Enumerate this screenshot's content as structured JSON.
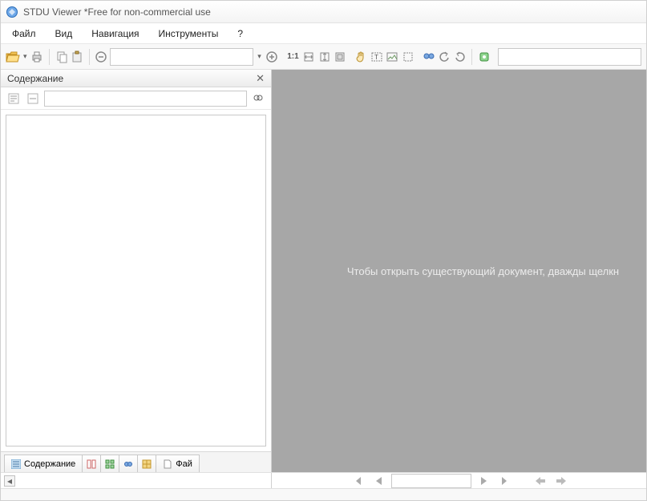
{
  "window": {
    "title": "STDU Viewer *Free for non-commercial use"
  },
  "menu": {
    "file": "Файл",
    "view": "Вид",
    "navigation": "Навигация",
    "tools": "Инструменты",
    "help": "?"
  },
  "toolbar": {
    "open": "open",
    "print": "print",
    "copy": "copy",
    "paste": "paste",
    "zoom_out": "zoom-out",
    "zoom_field": "",
    "zoom_in": "zoom-in",
    "scale_11": "1:1",
    "fit_width": "fit-width",
    "fit_height": "fit-height",
    "fit_page": "fit-page",
    "hand": "hand",
    "select": "select",
    "select_image": "select-image",
    "select_region": "select-region",
    "binoculars": "find",
    "rotate_left": "rotate-left",
    "rotate_right": "rotate-right",
    "settings": "settings",
    "help": "help",
    "search_field": ""
  },
  "sidebar": {
    "title": "Содержание",
    "filter_value": "",
    "tabs": {
      "contents": "Содержание",
      "pages": "",
      "bookmarks": "",
      "search": "",
      "thumbnails": "",
      "files": "Фай"
    }
  },
  "canvas": {
    "hint": "Чтобы открыть существующий документ, дважды щелкн"
  },
  "navigation": {
    "page_value": ""
  }
}
